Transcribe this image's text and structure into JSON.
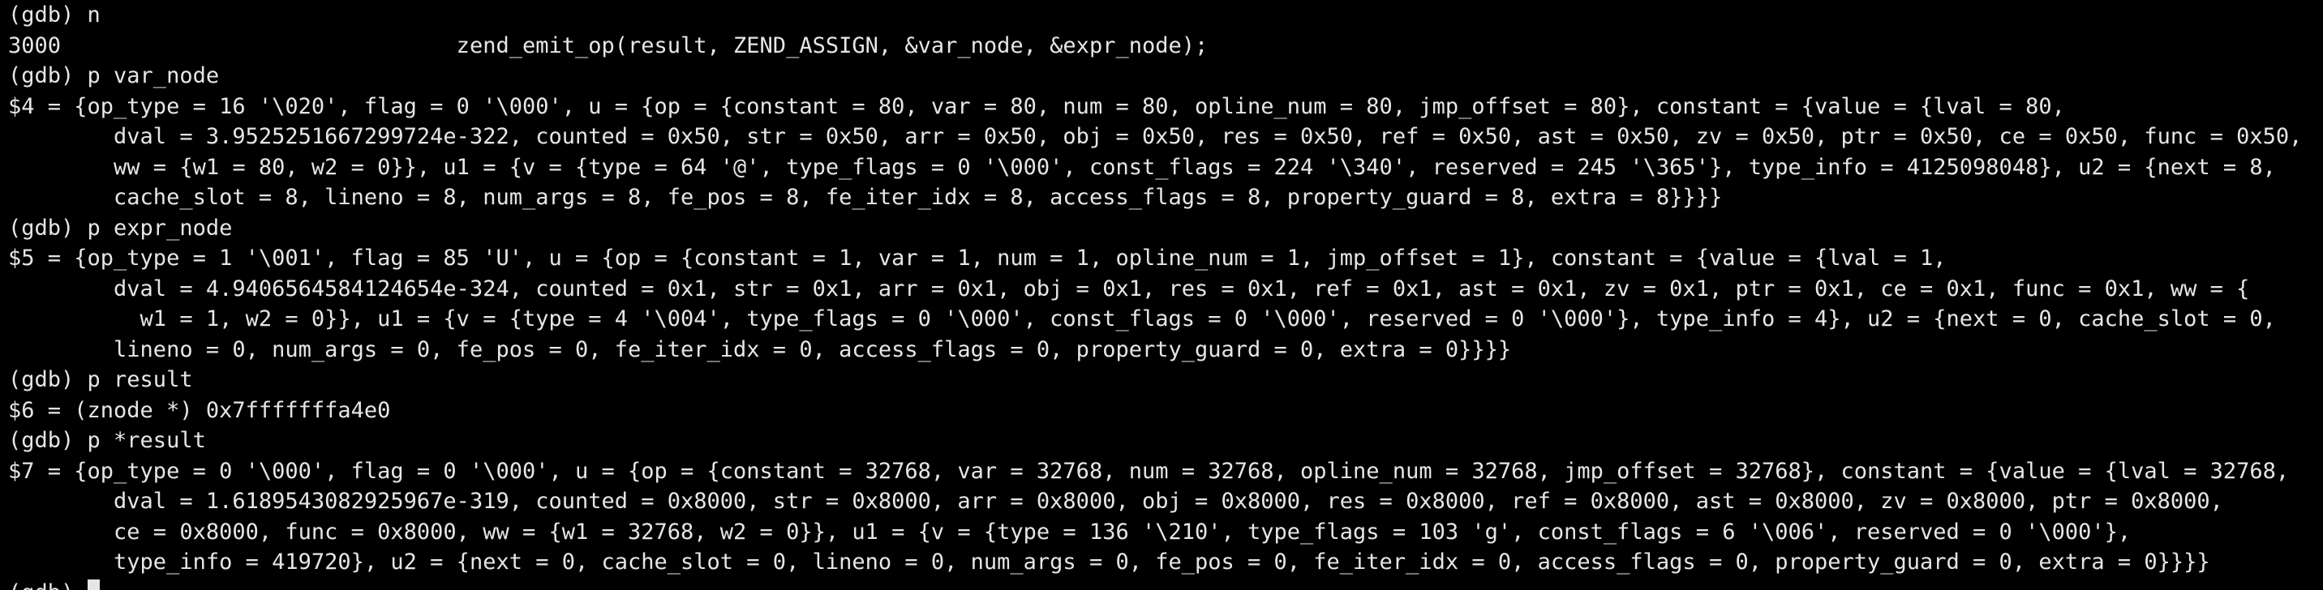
{
  "terminal": {
    "colors": {
      "background": "#000000",
      "foreground": "#e6e6e6",
      "cursor": "#e6e6e6"
    },
    "lines": [
      "(gdb) n",
      "3000                              zend_emit_op(result, ZEND_ASSIGN, &var_node, &expr_node);",
      "(gdb) p var_node",
      "$4 = {op_type = 16 '\\020', flag = 0 '\\000', u = {op = {constant = 80, var = 80, num = 80, opline_num = 80, jmp_offset = 80}, constant = {value = {lval = 80,",
      "        dval = 3.9525251667299724e-322, counted = 0x50, str = 0x50, arr = 0x50, obj = 0x50, res = 0x50, ref = 0x50, ast = 0x50, zv = 0x50, ptr = 0x50, ce = 0x50, func = 0x50,",
      "        ww = {w1 = 80, w2 = 0}}, u1 = {v = {type = 64 '@', type_flags = 0 '\\000', const_flags = 224 '\\340', reserved = 245 '\\365'}, type_info = 4125098048}, u2 = {next = 8,",
      "        cache_slot = 8, lineno = 8, num_args = 8, fe_pos = 8, fe_iter_idx = 8, access_flags = 8, property_guard = 8, extra = 8}}}}",
      "(gdb) p expr_node",
      "$5 = {op_type = 1 '\\001', flag = 85 'U', u = {op = {constant = 1, var = 1, num = 1, opline_num = 1, jmp_offset = 1}, constant = {value = {lval = 1,",
      "        dval = 4.9406564584124654e-324, counted = 0x1, str = 0x1, arr = 0x1, obj = 0x1, res = 0x1, ref = 0x1, ast = 0x1, zv = 0x1, ptr = 0x1, ce = 0x1, func = 0x1, ww = {",
      "          w1 = 1, w2 = 0}}, u1 = {v = {type = 4 '\\004', type_flags = 0 '\\000', const_flags = 0 '\\000', reserved = 0 '\\000'}, type_info = 4}, u2 = {next = 0, cache_slot = 0,",
      "        lineno = 0, num_args = 0, fe_pos = 0, fe_iter_idx = 0, access_flags = 0, property_guard = 0, extra = 0}}}}",
      "(gdb) p result",
      "$6 = (znode *) 0x7fffffffa4e0",
      "(gdb) p *result",
      "$7 = {op_type = 0 '\\000', flag = 0 '\\000', u = {op = {constant = 32768, var = 32768, num = 32768, opline_num = 32768, jmp_offset = 32768}, constant = {value = {lval = 32768,",
      "        dval = 1.6189543082925967e-319, counted = 0x8000, str = 0x8000, arr = 0x8000, obj = 0x8000, res = 0x8000, ref = 0x8000, ast = 0x8000, zv = 0x8000, ptr = 0x8000,",
      "        ce = 0x8000, func = 0x8000, ww = {w1 = 32768, w2 = 0}}, u1 = {v = {type = 136 '\\210', type_flags = 103 'g', const_flags = 6 '\\006', reserved = 0 '\\000'},",
      "        type_info = 419720}, u2 = {next = 0, cache_slot = 0, lineno = 0, num_args = 0, fe_pos = 0, fe_iter_idx = 0, access_flags = 0, property_guard = 0, extra = 0}}}}"
    ],
    "prompt": "(gdb) "
  }
}
